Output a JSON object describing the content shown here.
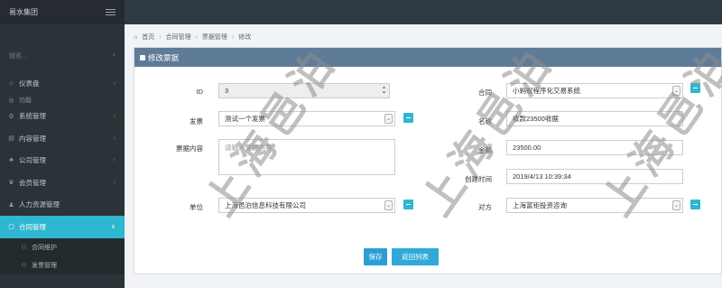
{
  "app": {
    "brand": "易水集团"
  },
  "sidebar": {
    "search_placeholder": "搜索...",
    "items": [
      {
        "icon": "home-icon",
        "label": "仪表盘",
        "chevron": "‹"
      },
      {
        "icon": "function-icon",
        "label": "功能",
        "section": true
      },
      {
        "icon": "settings-icon",
        "label": "系统管理",
        "chevron": "‹"
      },
      {
        "icon": "content-icon",
        "label": "内容管理",
        "chevron": "‹"
      },
      {
        "icon": "org-icon",
        "label": "公司管理",
        "chevron": "‹"
      },
      {
        "icon": "member-icon",
        "label": "会员管理",
        "chevron": "‹"
      },
      {
        "icon": "hr-icon",
        "label": "人力资源管理",
        "chevron": "‹"
      },
      {
        "icon": "contract-icon",
        "label": "合同管理",
        "chevron": "∨",
        "active": true
      }
    ],
    "sub_items": [
      {
        "label": "合同维护"
      },
      {
        "label": "发票管理"
      }
    ]
  },
  "breadcrumb": {
    "home": "首页",
    "level1": "合同管理",
    "level2": "票据管理",
    "current": "修改"
  },
  "panel": {
    "title": "修改票据"
  },
  "form": {
    "id_label": "ID",
    "id_value": "3",
    "invoice_label": "发票",
    "invoice_value": "测试一个发票",
    "content_label": "票据内容",
    "content_placeholder": "请输入票据内容",
    "unit_label": "单位",
    "unit_value": "上海邑泊信息科技有限公司",
    "contract_label": "合同",
    "contract_value": "小蚂蚁程序化交易系统",
    "name_label": "名称",
    "name_value": "收款23500收据",
    "amount_label": "金额",
    "amount_value": "23500.00",
    "created_label": "创建时间",
    "created_value": "2019/4/13 10:39:34",
    "party_label": "对方",
    "party_value": "上海富钜投资咨询"
  },
  "buttons": {
    "save": "保存",
    "back": "返回列表"
  },
  "watermark": "上海邑泊",
  "colors": {
    "accent": "#2fb6d0",
    "panel_header": "#5e7b98",
    "sidebar": "#2c3338",
    "button": "#2a9fd6"
  }
}
